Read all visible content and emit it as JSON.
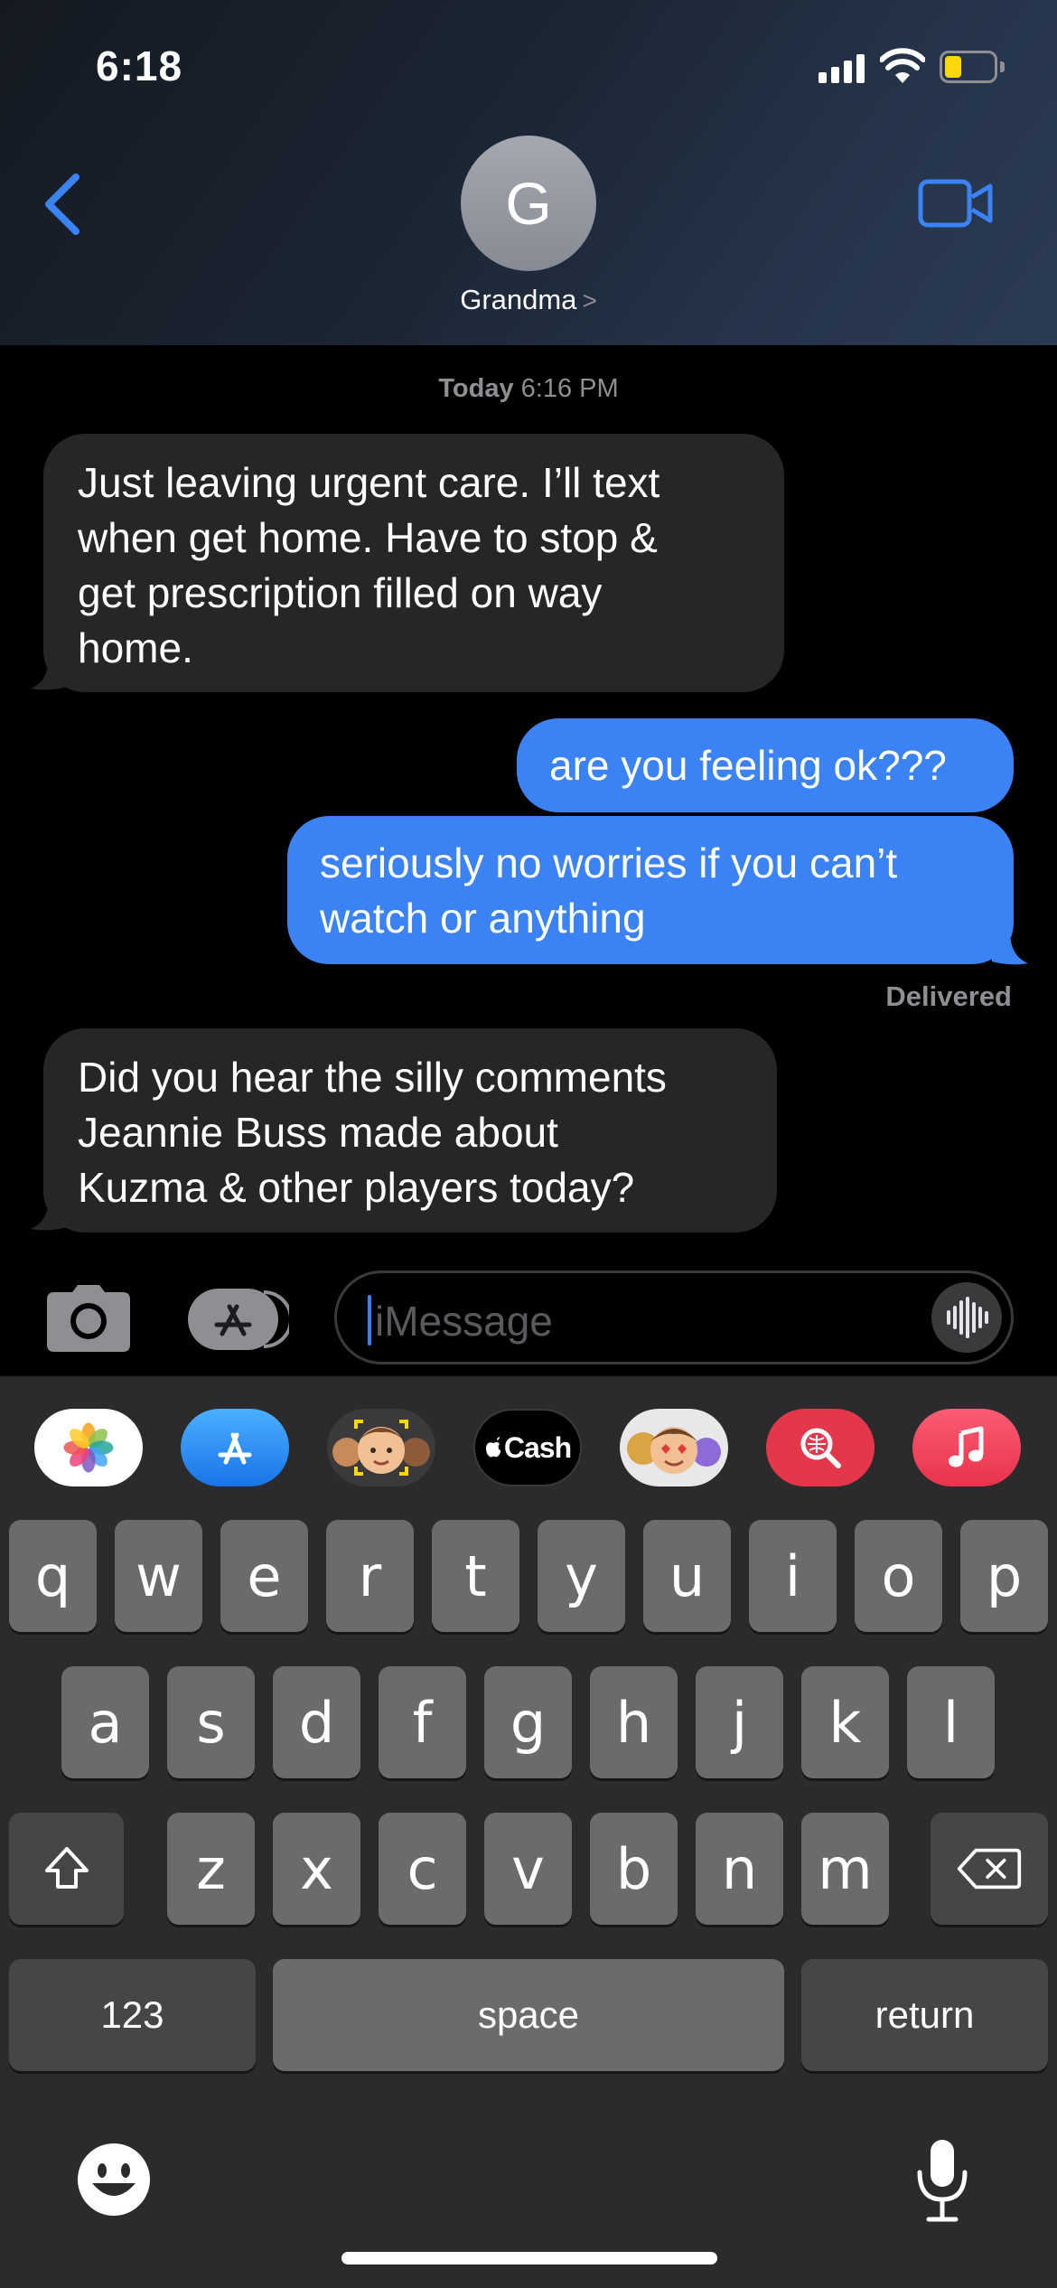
{
  "status_bar": {
    "time": "6:18",
    "battery_level": 0.25,
    "battery_color": "#ffd60a"
  },
  "header": {
    "back_icon": "chevron-left-icon",
    "avatar_initial": "G",
    "contact_name": "Grandma",
    "contact_chevron": ">",
    "video_icon": "video-camera-icon",
    "accent_color": "#3b82f4"
  },
  "conversation": {
    "timestamp_day": "Today",
    "timestamp_time": "6:16 PM",
    "messages": [
      {
        "direction": "incoming",
        "lines": [
          "Just leaving urgent care.  I’ll text",
          "when get home.  Have to stop &",
          "get prescription filled on way",
          "home."
        ]
      },
      {
        "direction": "outgoing",
        "lines": [
          "are you feeling ok???"
        ]
      },
      {
        "direction": "outgoing",
        "lines": [
          "seriously no worries if you can’t",
          "watch or anything"
        ]
      },
      {
        "direction": "incoming",
        "lines": [
          "Did you hear the silly comments",
          "Jeannie  Buss made about",
          "Kuzma & other players today?"
        ]
      }
    ],
    "delivered_label": "Delivered"
  },
  "compose": {
    "camera_icon": "camera-icon",
    "apps_icon": "app-store-icon",
    "placeholder": "iMessage",
    "audio_icon": "waveform-icon"
  },
  "app_drawer": [
    {
      "name": "photos-app-icon"
    },
    {
      "name": "app-store-app-icon"
    },
    {
      "name": "memoji-camera-app-icon"
    },
    {
      "name": "apple-cash-app-icon",
      "label": "Cash"
    },
    {
      "name": "memoji-stickers-app-icon"
    },
    {
      "name": "image-search-app-icon"
    },
    {
      "name": "music-app-icon"
    }
  ],
  "keyboard": {
    "row1": [
      "q",
      "w",
      "e",
      "r",
      "t",
      "y",
      "u",
      "i",
      "o",
      "p"
    ],
    "row2": [
      "a",
      "s",
      "d",
      "f",
      "g",
      "h",
      "j",
      "k",
      "l"
    ],
    "row3": [
      "z",
      "x",
      "c",
      "v",
      "b",
      "n",
      "m"
    ],
    "shift_icon": "shift-icon",
    "delete_icon": "delete-icon",
    "numbers_label": "123",
    "space_label": "space",
    "return_label": "return",
    "emoji_icon": "emoji-icon",
    "dictation_icon": "microphone-icon"
  }
}
